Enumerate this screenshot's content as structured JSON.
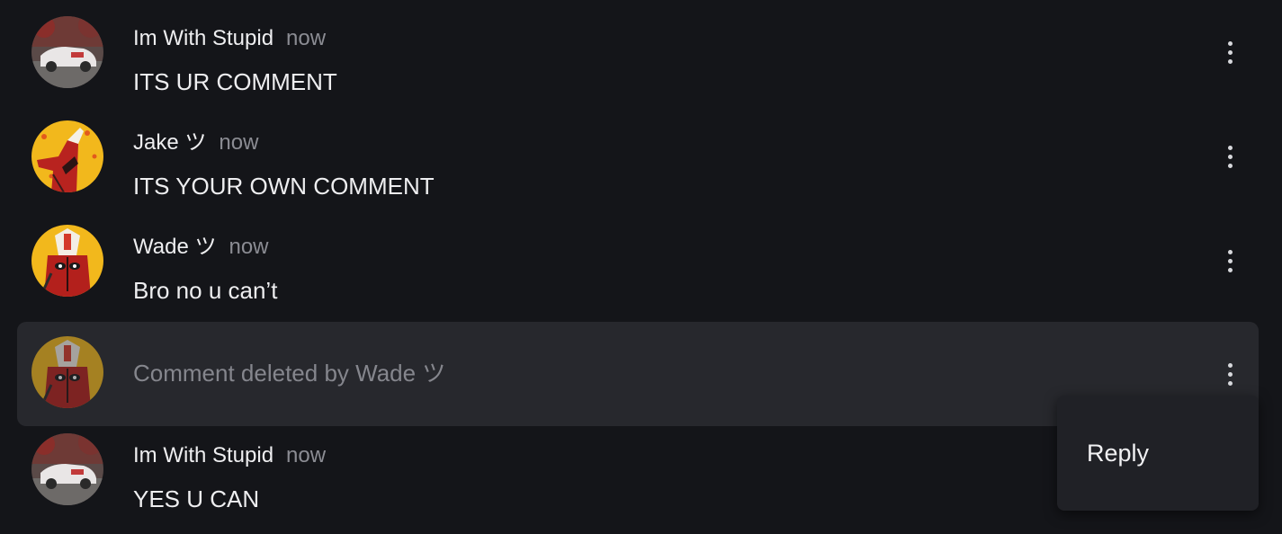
{
  "comments": [
    {
      "author": "Im With Stupid",
      "time": "now",
      "text": "ITS UR COMMENT",
      "avatar": "car-avatar"
    },
    {
      "author": "Jake ツ",
      "time": "now",
      "text": "ITS YOUR OWN COMMENT",
      "avatar": "spiderman-avatar"
    },
    {
      "author": "Wade ツ",
      "time": "now",
      "text": "Bro no u can’t",
      "avatar": "deadpool-avatar"
    },
    {
      "deleted_text": "Comment deleted by Wade ツ",
      "avatar": "deadpool-avatar"
    },
    {
      "author": "Im With Stupid",
      "time": "now",
      "text": "YES U CAN",
      "avatar": "car-avatar"
    }
  ],
  "context_menu": {
    "items": [
      {
        "label": "Reply"
      }
    ]
  },
  "colors": {
    "background": "#141519",
    "highlight_row": "#27282d",
    "menu_background": "#202126",
    "muted_text": "#8b8c93"
  }
}
